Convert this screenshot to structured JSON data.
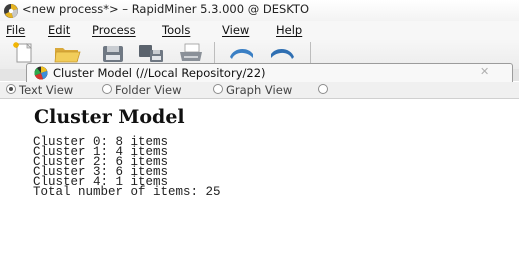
{
  "window": {
    "title": "<new process*> – RapidMiner 5.3.000 @ DESKTO"
  },
  "menu": [
    {
      "label": "File"
    },
    {
      "label": "Edit"
    },
    {
      "label": "Process"
    },
    {
      "label": "Tools"
    },
    {
      "label": "View"
    },
    {
      "label": "Help"
    }
  ],
  "toolbar": {
    "buttons": [
      {
        "icon": "new-process-icon"
      },
      {
        "icon": "open-folder-icon"
      },
      {
        "icon": "save-icon"
      },
      {
        "icon": "save-as-icon"
      },
      {
        "icon": "print-icon"
      },
      {
        "icon": "undo-icon"
      },
      {
        "icon": "redo-icon"
      }
    ]
  },
  "tab": {
    "label": "Cluster Model (//Local Repository/22)",
    "icon": "cluster-model-icon",
    "close_icon": "close-icon"
  },
  "views": [
    {
      "label": "Text View",
      "selected": true
    },
    {
      "label": "Folder View",
      "selected": false
    },
    {
      "label": "Graph View",
      "selected": false
    }
  ],
  "model": {
    "title": "Cluster Model",
    "lines": [
      "Cluster 0: 8 items",
      "Cluster 1: 4 items",
      "Cluster 2: 6 items",
      "Cluster 3: 6 items",
      "Cluster 4: 1 items",
      "Total number of items: 25"
    ]
  },
  "colors": {
    "toolbar_icon_blue": "#3a7fc4",
    "folder_yellow": "#e9c04a"
  }
}
